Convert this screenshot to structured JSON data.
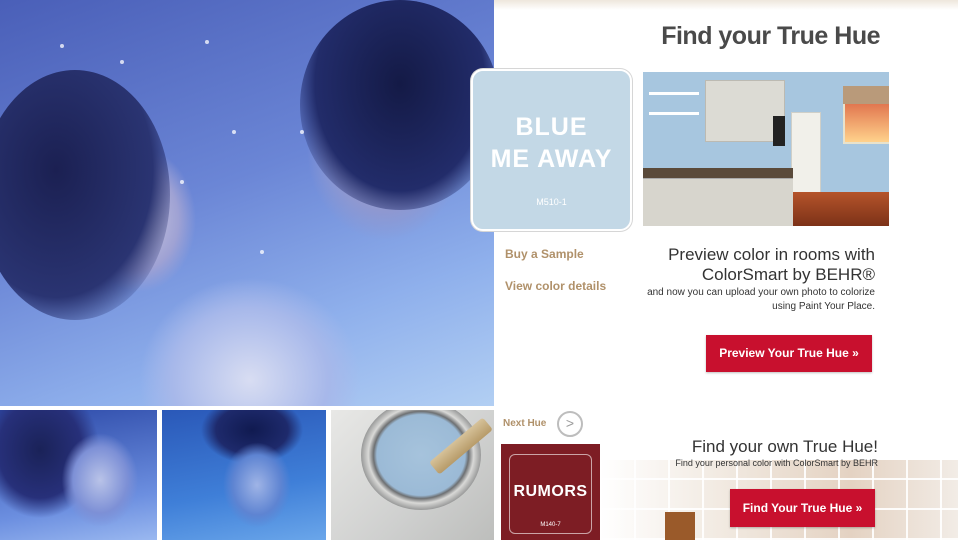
{
  "header": {
    "title": "Find your True Hue"
  },
  "swatch": {
    "name_line1": "BLUE",
    "name_line2": "ME AWAY",
    "code": "M510-1",
    "color": "#c3d8e6"
  },
  "links": {
    "buy_sample": "Buy a Sample",
    "view_details": "View color details"
  },
  "preview": {
    "heading_line1": "Preview color in rooms with",
    "heading_line2": "ColorSmart by BEHR®",
    "sub_line1": "and now you can upload your own photo to colorize",
    "sub_line2": "using Paint Your Place.",
    "button": "Preview Your True Hue  »"
  },
  "next_hue": {
    "label": "Next Hue",
    "arrow": ">",
    "name": "RUMORS",
    "code": "M140-7",
    "color": "#7d1d24"
  },
  "find_own": {
    "heading": "Find your own True Hue!",
    "sub": "Find your personal color with ColorSmart by BEHR",
    "button": "Find Your True Hue  »"
  },
  "colors": {
    "accent": "#c8102e",
    "link": "#b0916a"
  }
}
